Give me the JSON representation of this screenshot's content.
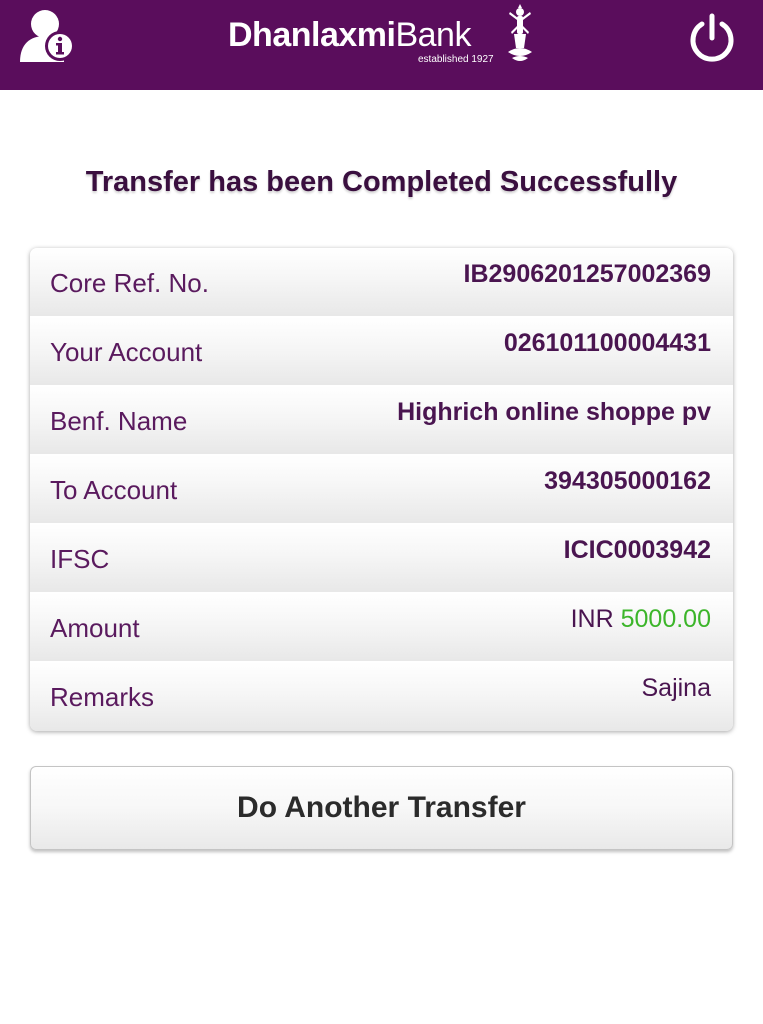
{
  "header": {
    "logo": {
      "bold_text": "Dhanlaxmi",
      "light_text": "Bank",
      "tagline": "established 1927"
    },
    "left_icon": "user-info-icon",
    "right_icon": "power-icon",
    "background_color": "#5a0d5c"
  },
  "status_message": "Transfer has been Completed Successfully",
  "details": [
    {
      "label": "Core Ref. No.",
      "value": "IB2906201257002369"
    },
    {
      "label": "Your Account",
      "value": "026101100004431"
    },
    {
      "label": "Benf. Name",
      "value": "Highrich online shoppe pv"
    },
    {
      "label": "To Account",
      "value": "394305000162"
    },
    {
      "label": "IFSC",
      "value": "ICIC0003942"
    },
    {
      "label": "Amount",
      "currency": "INR",
      "value": "5000.00"
    },
    {
      "label": "Remarks",
      "value": "Sajina"
    }
  ],
  "actions": {
    "another_transfer_label": "Do Another Transfer"
  },
  "colors": {
    "brand_purple": "#5a0d5c",
    "amount_green": "#3cb52a",
    "title_text": "#3a0f3f"
  }
}
